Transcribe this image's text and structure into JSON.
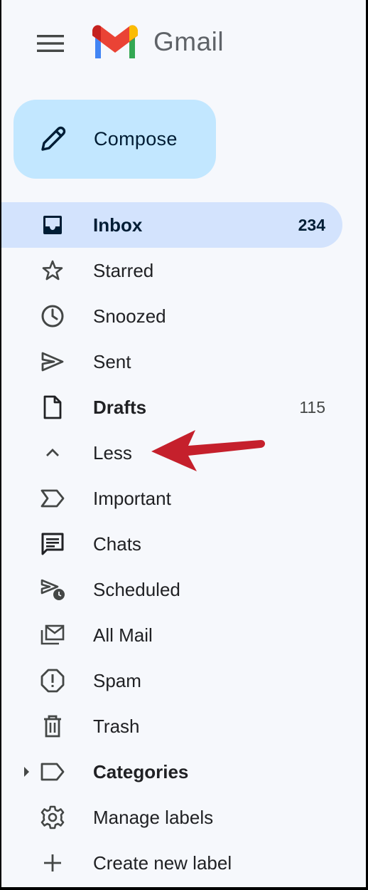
{
  "app": {
    "name": "Gmail"
  },
  "compose": {
    "label": "Compose"
  },
  "nav": {
    "items": [
      {
        "label": "Inbox",
        "count": "234",
        "icon": "inbox-icon",
        "active": true,
        "bold": true
      },
      {
        "label": "Starred",
        "count": "",
        "icon": "star-icon"
      },
      {
        "label": "Snoozed",
        "count": "",
        "icon": "clock-icon"
      },
      {
        "label": "Sent",
        "count": "",
        "icon": "send-icon"
      },
      {
        "label": "Drafts",
        "count": "115",
        "icon": "draft-icon",
        "bold": true
      },
      {
        "label": "Less",
        "count": "",
        "icon": "chevron-up-icon"
      },
      {
        "label": "Important",
        "count": "",
        "icon": "important-icon"
      },
      {
        "label": "Chats",
        "count": "",
        "icon": "chat-icon"
      },
      {
        "label": "Scheduled",
        "count": "",
        "icon": "scheduled-send-icon"
      },
      {
        "label": "All Mail",
        "count": "",
        "icon": "all-mail-icon"
      },
      {
        "label": "Spam",
        "count": "",
        "icon": "spam-icon"
      },
      {
        "label": "Trash",
        "count": "",
        "icon": "trash-icon"
      },
      {
        "label": "Categories",
        "count": "",
        "icon": "label-icon",
        "bold": true
      },
      {
        "label": "Manage labels",
        "count": "",
        "icon": "gear-icon"
      },
      {
        "label": "Create new label",
        "count": "",
        "icon": "plus-icon"
      }
    ]
  },
  "colors": {
    "sidebar_bg": "#f6f8fc",
    "active_bg": "#d3e3fd",
    "compose_bg": "#c2e7ff",
    "annotation_arrow": "#c5202c"
  }
}
